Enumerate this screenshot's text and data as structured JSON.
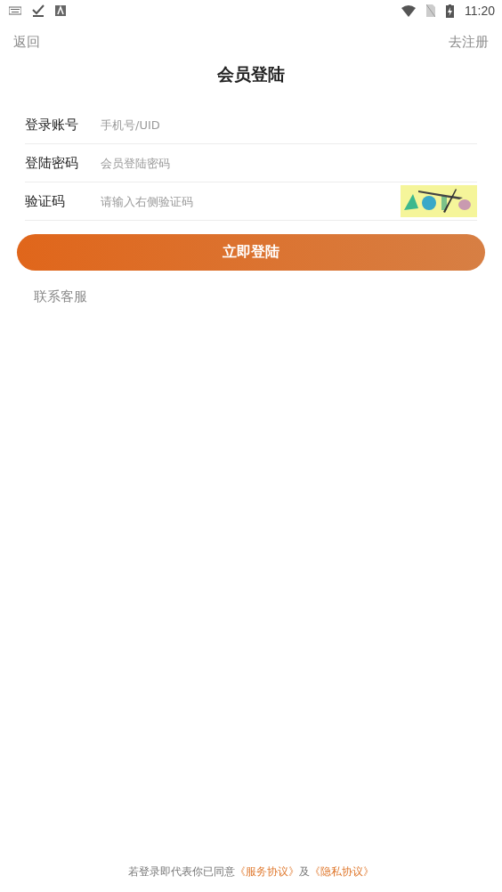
{
  "status_bar": {
    "time": "11:20"
  },
  "nav": {
    "back": "返回",
    "register": "去注册"
  },
  "title": "会员登陆",
  "fields": [
    {
      "label": "登录账号",
      "placeholder": "手机号/UID",
      "kind": "text"
    },
    {
      "label": "登陆密码",
      "placeholder": "会员登陆密码",
      "kind": "password"
    },
    {
      "label": "验证码",
      "placeholder": "请输入右侧验证码",
      "kind": "captcha"
    }
  ],
  "login_button": "立即登陆",
  "support_link": "联系客服",
  "footer": [
    {
      "kind": "text",
      "text": "若登录即代表你已同意"
    },
    {
      "kind": "link",
      "text": "《服务协议》"
    },
    {
      "kind": "text",
      "text": "及"
    },
    {
      "kind": "link",
      "text": "《隐私协议》"
    }
  ]
}
